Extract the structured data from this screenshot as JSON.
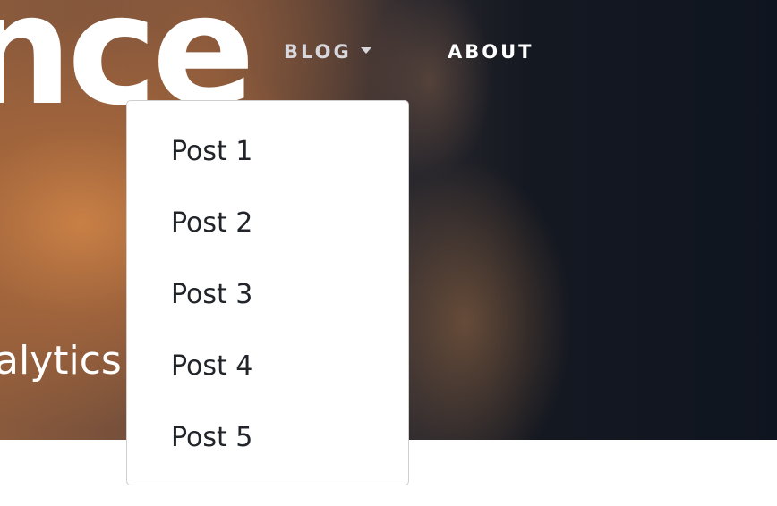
{
  "hero": {
    "title": "nce",
    "subtitle": "alytics"
  },
  "nav": {
    "blog_label": "BLOG",
    "about_label": "ABOUT"
  },
  "dropdown": {
    "items": [
      {
        "label": "Post 1"
      },
      {
        "label": "Post 2"
      },
      {
        "label": "Post 3"
      },
      {
        "label": "Post 4"
      },
      {
        "label": "Post 5"
      }
    ]
  },
  "icons": {
    "blog_caret": "caret-down-icon"
  },
  "colors": {
    "nav_blog": "#d7d7dc",
    "nav_about": "#ffffff",
    "dropdown_text": "#212529",
    "dropdown_border": "#cfcfcf"
  }
}
